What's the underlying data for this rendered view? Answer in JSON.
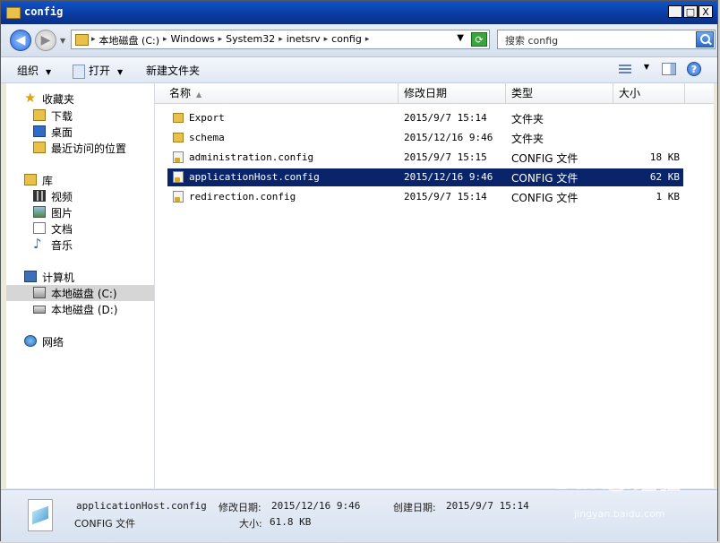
{
  "window": {
    "title": "config",
    "controls": [
      "_",
      "□",
      "X"
    ]
  },
  "address": {
    "crumbs": [
      "本地磁盘 (C:)",
      "Windows",
      "System32",
      "inetsrv",
      "config"
    ],
    "search_placeholder": "搜索 config"
  },
  "toolbar": {
    "organize": "组织",
    "open": "打开",
    "new_folder": "新建文件夹"
  },
  "nav": {
    "favorites": "收藏夹",
    "downloads": "下载",
    "desktop": "桌面",
    "recent": "最近访问的位置",
    "libraries": "库",
    "videos": "视频",
    "pictures": "图片",
    "documents": "文档",
    "music": "音乐",
    "computer": "计算机",
    "drive_c": "本地磁盘 (C:)",
    "drive_d": "本地磁盘 (D:)",
    "network": "网络"
  },
  "columns": {
    "name": "名称",
    "date": "修改日期",
    "type": "类型",
    "size": "大小"
  },
  "files": [
    {
      "name": "Export",
      "date": "2015/9/7 15:14",
      "type": "文件夹",
      "size": "",
      "kind": "folder"
    },
    {
      "name": "schema",
      "date": "2015/12/16 9:46",
      "type": "文件夹",
      "size": "",
      "kind": "folder"
    },
    {
      "name": "administration.config",
      "date": "2015/9/7 15:15",
      "type": "CONFIG 文件",
      "size": "18 KB",
      "kind": "config"
    },
    {
      "name": "applicationHost.config",
      "date": "2015/12/16 9:46",
      "type": "CONFIG 文件",
      "size": "62 KB",
      "kind": "config",
      "selected": true
    },
    {
      "name": "redirection.config",
      "date": "2015/9/7 15:14",
      "type": "CONFIG 文件",
      "size": "1 KB",
      "kind": "config"
    }
  ],
  "details": {
    "filename": "applicationHost.config",
    "modified_label": "修改日期:",
    "modified_value": "2015/12/16 9:46",
    "created_label": "创建日期:",
    "created_value": "2015/9/7 15:14",
    "filetype": "CONFIG 文件",
    "size_label": "大小:",
    "size_value": "61.8 KB"
  },
  "watermark": {
    "text": "Baidu经验",
    "sub": "jingyan.baidu.com"
  }
}
